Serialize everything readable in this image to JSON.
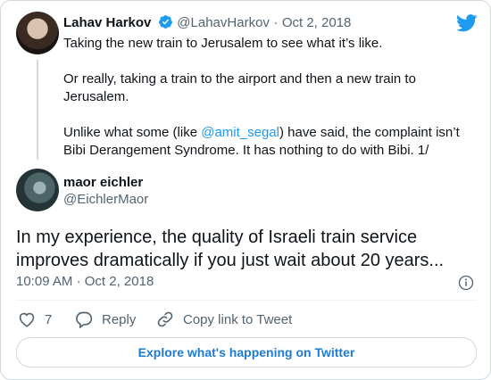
{
  "parent_tweet": {
    "author_name": "Lahav Harkov",
    "handle": "@LahavHarkov",
    "dot": "·",
    "date": "Oct 2, 2018",
    "line1": "Taking the new train to Jerusalem to see what it’s like.",
    "para2_line1": "Or really, taking a train to the airport and then a new train to",
    "para2_line2": "Jerusalem.",
    "para3_before": "Unlike what some (like ",
    "para3_mention": "@amit_segal",
    "para3_after": ") have said, the complaint isn’t",
    "para3_line2": "Bibi Derangement Syndrome. It has nothing to do with Bibi. 1/"
  },
  "tweet": {
    "author_name": "maor eichler",
    "handle": "@EichlerMaor",
    "text_line1": "In my experience, the quality of Israeli train service",
    "text_line2": "improves dramatically if you just wait about 20 years...",
    "time": "10:09 AM",
    "dot": "·",
    "date": "Oct 2, 2018"
  },
  "actions": {
    "like_count": "7",
    "reply_label": "Reply",
    "copy_link_label": "Copy link to Tweet"
  },
  "explore_label": "Explore what's happening on Twitter",
  "colors": {
    "twitter_blue": "#1d9bf0",
    "text": "#0f1419",
    "secondary": "#536471"
  },
  "icons": [
    "twitter-bird-icon",
    "verified-badge-icon",
    "info-icon",
    "heart-icon",
    "reply-icon",
    "link-icon"
  ]
}
